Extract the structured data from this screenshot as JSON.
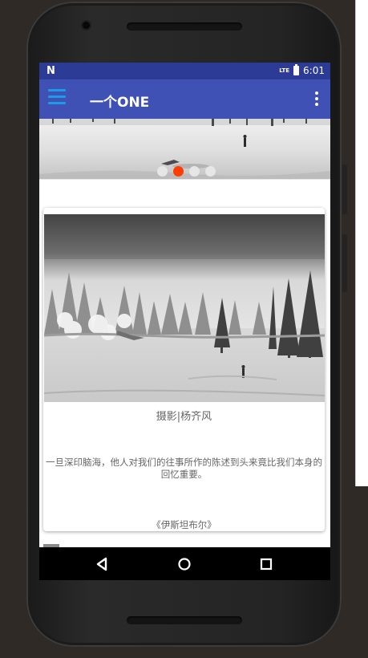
{
  "status_bar": {
    "network_indicator": "N",
    "lte_label": "LTE",
    "time": "6:01",
    "icons": [
      "network-icon",
      "lte-icon",
      "battery-icon"
    ]
  },
  "app_bar": {
    "title": "一个ONE",
    "menu_icon": "hamburger-icon",
    "overflow_icon": "more-vert-icon",
    "colors": {
      "primary": "#3f51b5",
      "status": "#2c3c96",
      "menu_accent": "#1e9be6"
    }
  },
  "banner": {
    "slide_count": 4,
    "active_index": 1,
    "indicator_active_color": "#ff3d00",
    "indicator_inactive_color": "#e6e6e6"
  },
  "card": {
    "photo_credit": "摄影|杨齐风",
    "quote": "一旦深印脑海，他人对我们的往事所作的陈述到头来竟比我们本身的回忆重要。",
    "source": "《伊斯坦布尔》"
  },
  "nav": {
    "back_icon": "back-triangle-icon",
    "home_icon": "home-circle-icon",
    "recents_icon": "recents-square-icon"
  }
}
